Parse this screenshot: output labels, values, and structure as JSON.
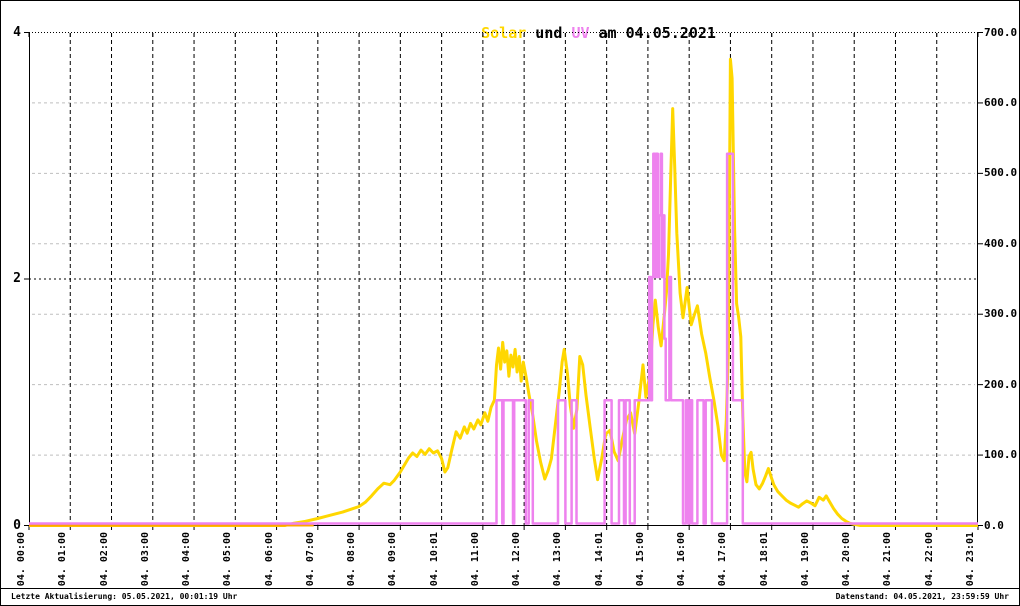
{
  "title": {
    "solar": "Solar",
    "mid": " und ",
    "uv": "UV",
    "rest": " am 04.05.2021"
  },
  "footer": {
    "left": "Letzte Aktualisierung: 05.05.2021, 00:01:19 Uhr",
    "right": "Datenstand: 04.05.2021, 23:59:59 Uhr"
  },
  "colors": {
    "solar": "#FFD700",
    "uv": "#EE82EE",
    "baseline": "#FFA500",
    "grid_gray": "#BFBFBF",
    "grid_black": "#000000",
    "axis": "#000000"
  },
  "chart_data": {
    "type": "line",
    "title": "Solar und UV am 04.05.2021",
    "x_unit": "hours",
    "x_range": [
      0,
      23
    ],
    "grid": true,
    "legend_position": "none",
    "left_axis": {
      "range": [
        0,
        4
      ],
      "tick_values": [
        0,
        2,
        4
      ],
      "tick_labels": [
        "0",
        "2",
        "4"
      ],
      "series": "UV"
    },
    "right_axis": {
      "range": [
        0,
        700
      ],
      "tick_values": [
        0,
        100,
        200,
        300,
        400,
        500,
        600,
        700
      ],
      "tick_labels": [
        "0.0",
        "100.0",
        "200.0",
        "300.0",
        "400.0",
        "500.0",
        "600.0",
        "700.0"
      ],
      "series": "Solar"
    },
    "x_tick_labels": [
      "04. 00:00",
      "04. 01:00",
      "04. 02:00",
      "04. 03:00",
      "04. 04:00",
      "04. 05:00",
      "04. 06:00",
      "04. 07:00",
      "04. 08:00",
      "04. 09:00",
      "04. 10:01",
      "04. 11:00",
      "04. 12:00",
      "04. 13:00",
      "04. 14:01",
      "04. 15:00",
      "04. 16:00",
      "04. 17:00",
      "04. 18:01",
      "04. 19:00",
      "04. 20:00",
      "04. 21:00",
      "04. 22:00",
      "04. 23:01"
    ],
    "series": [
      {
        "name": "Solar",
        "axis": "right",
        "color": "#FFD700",
        "width": 3,
        "points": [
          [
            0,
            0
          ],
          [
            6.2,
            0
          ],
          [
            6.4,
            3
          ],
          [
            6.7,
            6
          ],
          [
            7.0,
            10
          ],
          [
            7.2,
            13
          ],
          [
            7.4,
            16
          ],
          [
            7.6,
            19
          ],
          [
            7.8,
            23
          ],
          [
            8.0,
            27
          ],
          [
            8.15,
            33
          ],
          [
            8.3,
            42
          ],
          [
            8.45,
            52
          ],
          [
            8.6,
            60
          ],
          [
            8.75,
            58
          ],
          [
            8.85,
            64
          ],
          [
            9.0,
            76
          ],
          [
            9.1,
            86
          ],
          [
            9.2,
            96
          ],
          [
            9.3,
            103
          ],
          [
            9.4,
            98
          ],
          [
            9.5,
            107
          ],
          [
            9.6,
            101
          ],
          [
            9.7,
            109
          ],
          [
            9.8,
            103
          ],
          [
            9.9,
            106
          ],
          [
            10.0,
            95
          ],
          [
            10.08,
            76
          ],
          [
            10.15,
            82
          ],
          [
            10.25,
            108
          ],
          [
            10.35,
            133
          ],
          [
            10.45,
            124
          ],
          [
            10.55,
            140
          ],
          [
            10.62,
            131
          ],
          [
            10.7,
            145
          ],
          [
            10.78,
            137
          ],
          [
            10.88,
            150
          ],
          [
            10.95,
            143
          ],
          [
            11.05,
            160
          ],
          [
            11.12,
            148
          ],
          [
            11.2,
            168
          ],
          [
            11.28,
            178
          ],
          [
            11.33,
            228
          ],
          [
            11.38,
            252
          ],
          [
            11.43,
            222
          ],
          [
            11.48,
            260
          ],
          [
            11.53,
            232
          ],
          [
            11.58,
            248
          ],
          [
            11.63,
            212
          ],
          [
            11.68,
            242
          ],
          [
            11.73,
            225
          ],
          [
            11.78,
            250
          ],
          [
            11.83,
            218
          ],
          [
            11.88,
            240
          ],
          [
            11.93,
            205
          ],
          [
            11.98,
            232
          ],
          [
            12.05,
            210
          ],
          [
            12.12,
            185
          ],
          [
            12.2,
            160
          ],
          [
            12.3,
            120
          ],
          [
            12.4,
            90
          ],
          [
            12.5,
            66
          ],
          [
            12.58,
            78
          ],
          [
            12.66,
            95
          ],
          [
            12.75,
            140
          ],
          [
            12.85,
            190
          ],
          [
            12.92,
            232
          ],
          [
            12.97,
            250
          ],
          [
            13.05,
            215
          ],
          [
            13.12,
            170
          ],
          [
            13.2,
            138
          ],
          [
            13.28,
            165
          ],
          [
            13.35,
            240
          ],
          [
            13.42,
            228
          ],
          [
            13.5,
            185
          ],
          [
            13.6,
            140
          ],
          [
            13.7,
            95
          ],
          [
            13.78,
            65
          ],
          [
            13.88,
            95
          ],
          [
            13.98,
            130
          ],
          [
            14.08,
            135
          ],
          [
            14.18,
            105
          ],
          [
            14.28,
            92
          ],
          [
            14.38,
            122
          ],
          [
            14.48,
            150
          ],
          [
            14.58,
            160
          ],
          [
            14.68,
            130
          ],
          [
            14.78,
            175
          ],
          [
            14.88,
            228
          ],
          [
            14.95,
            182
          ],
          [
            15.05,
            215
          ],
          [
            15.12,
            285
          ],
          [
            15.18,
            320
          ],
          [
            15.25,
            282
          ],
          [
            15.32,
            255
          ],
          [
            15.4,
            300
          ],
          [
            15.45,
            332
          ],
          [
            15.5,
            385
          ],
          [
            15.55,
            490
          ],
          [
            15.6,
            592
          ],
          [
            15.65,
            510
          ],
          [
            15.7,
            415
          ],
          [
            15.78,
            330
          ],
          [
            15.85,
            295
          ],
          [
            15.95,
            338
          ],
          [
            16.05,
            285
          ],
          [
            16.12,
            298
          ],
          [
            16.2,
            312
          ],
          [
            16.3,
            272
          ],
          [
            16.4,
            245
          ],
          [
            16.5,
            210
          ],
          [
            16.6,
            178
          ],
          [
            16.7,
            140
          ],
          [
            16.78,
            100
          ],
          [
            16.85,
            92
          ],
          [
            16.9,
            150
          ],
          [
            16.95,
            250
          ],
          [
            17.0,
            662
          ],
          [
            17.04,
            635
          ],
          [
            17.1,
            420
          ],
          [
            17.15,
            315
          ],
          [
            17.2,
            295
          ],
          [
            17.25,
            268
          ],
          [
            17.3,
            155
          ],
          [
            17.35,
            75
          ],
          [
            17.4,
            62
          ],
          [
            17.45,
            98
          ],
          [
            17.5,
            104
          ],
          [
            17.55,
            80
          ],
          [
            17.62,
            58
          ],
          [
            17.7,
            52
          ],
          [
            17.78,
            60
          ],
          [
            17.85,
            70
          ],
          [
            17.92,
            81
          ],
          [
            17.98,
            70
          ],
          [
            18.05,
            58
          ],
          [
            18.15,
            48
          ],
          [
            18.25,
            42
          ],
          [
            18.35,
            36
          ],
          [
            18.45,
            32
          ],
          [
            18.55,
            29
          ],
          [
            18.65,
            26
          ],
          [
            18.75,
            31
          ],
          [
            18.85,
            35
          ],
          [
            18.95,
            32
          ],
          [
            19.05,
            28
          ],
          [
            19.15,
            40
          ],
          [
            19.25,
            36
          ],
          [
            19.32,
            42
          ],
          [
            19.4,
            34
          ],
          [
            19.5,
            24
          ],
          [
            19.6,
            16
          ],
          [
            19.7,
            10
          ],
          [
            19.8,
            6
          ],
          [
            19.9,
            3
          ],
          [
            20.05,
            1
          ],
          [
            20.15,
            0
          ],
          [
            23,
            0
          ]
        ]
      },
      {
        "name": "UV",
        "axis": "left",
        "color": "#EE82EE",
        "width": 2.5,
        "points": [
          [
            0,
            0
          ],
          [
            11.33,
            0
          ],
          [
            11.33,
            1
          ],
          [
            11.47,
            1
          ],
          [
            11.47,
            0
          ],
          [
            11.5,
            0
          ],
          [
            11.5,
            1
          ],
          [
            11.73,
            1
          ],
          [
            11.73,
            0
          ],
          [
            11.76,
            0
          ],
          [
            11.76,
            1
          ],
          [
            12.04,
            1
          ],
          [
            12.04,
            0
          ],
          [
            12.11,
            0
          ],
          [
            12.11,
            1
          ],
          [
            12.21,
            1
          ],
          [
            12.21,
            0
          ],
          [
            12.82,
            0
          ],
          [
            12.82,
            1
          ],
          [
            13.0,
            1
          ],
          [
            13.0,
            0
          ],
          [
            13.15,
            0
          ],
          [
            13.15,
            1
          ],
          [
            13.27,
            1
          ],
          [
            13.27,
            0
          ],
          [
            13.95,
            0
          ],
          [
            13.95,
            1
          ],
          [
            14.12,
            1
          ],
          [
            14.12,
            0
          ],
          [
            14.3,
            0
          ],
          [
            14.3,
            1
          ],
          [
            14.42,
            1
          ],
          [
            14.42,
            0
          ],
          [
            14.46,
            0
          ],
          [
            14.46,
            1
          ],
          [
            14.56,
            1
          ],
          [
            14.56,
            0
          ],
          [
            14.68,
            0
          ],
          [
            14.68,
            1
          ],
          [
            15.03,
            1
          ],
          [
            15.03,
            2
          ],
          [
            15.07,
            2
          ],
          [
            15.07,
            1
          ],
          [
            15.1,
            1
          ],
          [
            15.1,
            2
          ],
          [
            15.13,
            2
          ],
          [
            15.13,
            3
          ],
          [
            15.17,
            3
          ],
          [
            15.17,
            2
          ],
          [
            15.2,
            2
          ],
          [
            15.2,
            3
          ],
          [
            15.24,
            3
          ],
          [
            15.24,
            2
          ],
          [
            15.27,
            2
          ],
          [
            15.27,
            2.5
          ],
          [
            15.31,
            2.5
          ],
          [
            15.31,
            3
          ],
          [
            15.34,
            3
          ],
          [
            15.34,
            2
          ],
          [
            15.37,
            2
          ],
          [
            15.37,
            2.5
          ],
          [
            15.4,
            2.5
          ],
          [
            15.4,
            1.5
          ],
          [
            15.43,
            1.5
          ],
          [
            15.43,
            1
          ],
          [
            15.52,
            1
          ],
          [
            15.52,
            2
          ],
          [
            15.56,
            2
          ],
          [
            15.56,
            1
          ],
          [
            15.85,
            1
          ],
          [
            15.85,
            0
          ],
          [
            15.92,
            0
          ],
          [
            15.92,
            1
          ],
          [
            15.97,
            1
          ],
          [
            15.97,
            0
          ],
          [
            16.02,
            0
          ],
          [
            16.02,
            1
          ],
          [
            16.07,
            1
          ],
          [
            16.07,
            0
          ],
          [
            16.2,
            0
          ],
          [
            16.2,
            1
          ],
          [
            16.35,
            1
          ],
          [
            16.35,
            0
          ],
          [
            16.4,
            0
          ],
          [
            16.4,
            1
          ],
          [
            16.55,
            1
          ],
          [
            16.55,
            0
          ],
          [
            16.92,
            0
          ],
          [
            16.92,
            3
          ],
          [
            17.06,
            3
          ],
          [
            17.06,
            1
          ],
          [
            17.3,
            1
          ],
          [
            17.3,
            0
          ],
          [
            23,
            0
          ]
        ]
      },
      {
        "name": "baseline-zero",
        "axis": "right",
        "color": "#FFA500",
        "width": 3,
        "points": [
          [
            0,
            0
          ],
          [
            6.9,
            0
          ]
        ]
      }
    ]
  }
}
